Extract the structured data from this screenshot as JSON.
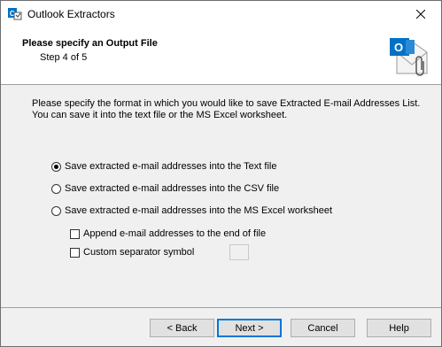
{
  "window": {
    "title": "Outlook Extractors"
  },
  "header": {
    "title": "Please specify an Output File",
    "step": "Step 4 of 5"
  },
  "description": {
    "line1": "Please specify the format in which you would like to save Extracted E-mail Addresses List.",
    "line2": "You can save it into the text file or the MS Excel worksheet."
  },
  "options": [
    {
      "label": "Save extracted e-mail addresses into the Text file",
      "selected": true
    },
    {
      "label": "Save extracted e-mail addresses into the CSV file",
      "selected": false
    },
    {
      "label": "Save extracted e-mail addresses into the MS Excel worksheet",
      "selected": false
    }
  ],
  "checkboxes": {
    "append": {
      "label": "Append e-mail addresses to the end of file",
      "checked": false
    },
    "separator": {
      "label": "Custom separator symbol",
      "checked": false,
      "value": ""
    }
  },
  "buttons": {
    "back": "< Back",
    "next": "Next >",
    "cancel": "Cancel",
    "help": "Help"
  },
  "icons": {
    "app": "outlook-extractor-app-icon",
    "header": "outlook-attachment-icon",
    "close": "close-icon"
  },
  "colors": {
    "outlook_blue": "#0072c6",
    "focus_border": "#0078d7"
  }
}
